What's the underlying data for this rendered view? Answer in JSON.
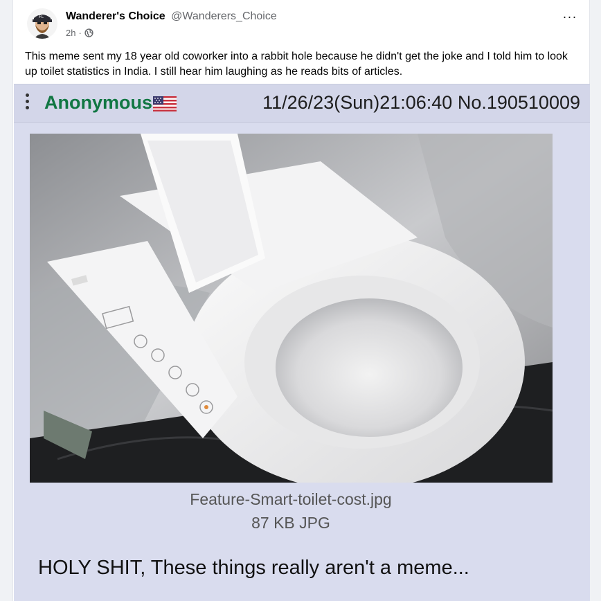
{
  "post": {
    "author_name": "Wanderer's Choice",
    "author_handle": "@Wanderers_Choice",
    "time_ago": "2h",
    "separator": "·",
    "more_label": "···",
    "text": "This meme sent my 18 year old coworker into a rabbit hole because he didn't get the joke and I told him to look up toilet statistics in India. I still hear him laughing as he reads bits of articles."
  },
  "meme": {
    "poster_name": "Anonymous",
    "post_info": "11/26/23(Sun)21:06:40 No.190510009",
    "filename": "Feature-Smart-toilet-cost.jpg",
    "filesize": "87 KB JPG",
    "comment": "HOLY SHIT, These things really aren't a meme..."
  },
  "icons": {
    "avatar": "bearded-man-avatar-icon",
    "privacy": "public-globe-icon",
    "more": "ellipsis-icon",
    "menu": "vertical-dots-icon",
    "flag": "us-flag-icon"
  },
  "colors": {
    "anon_green": "#117743",
    "meme_bg": "#d9dcee",
    "header_bg": "#d3d6e9"
  }
}
